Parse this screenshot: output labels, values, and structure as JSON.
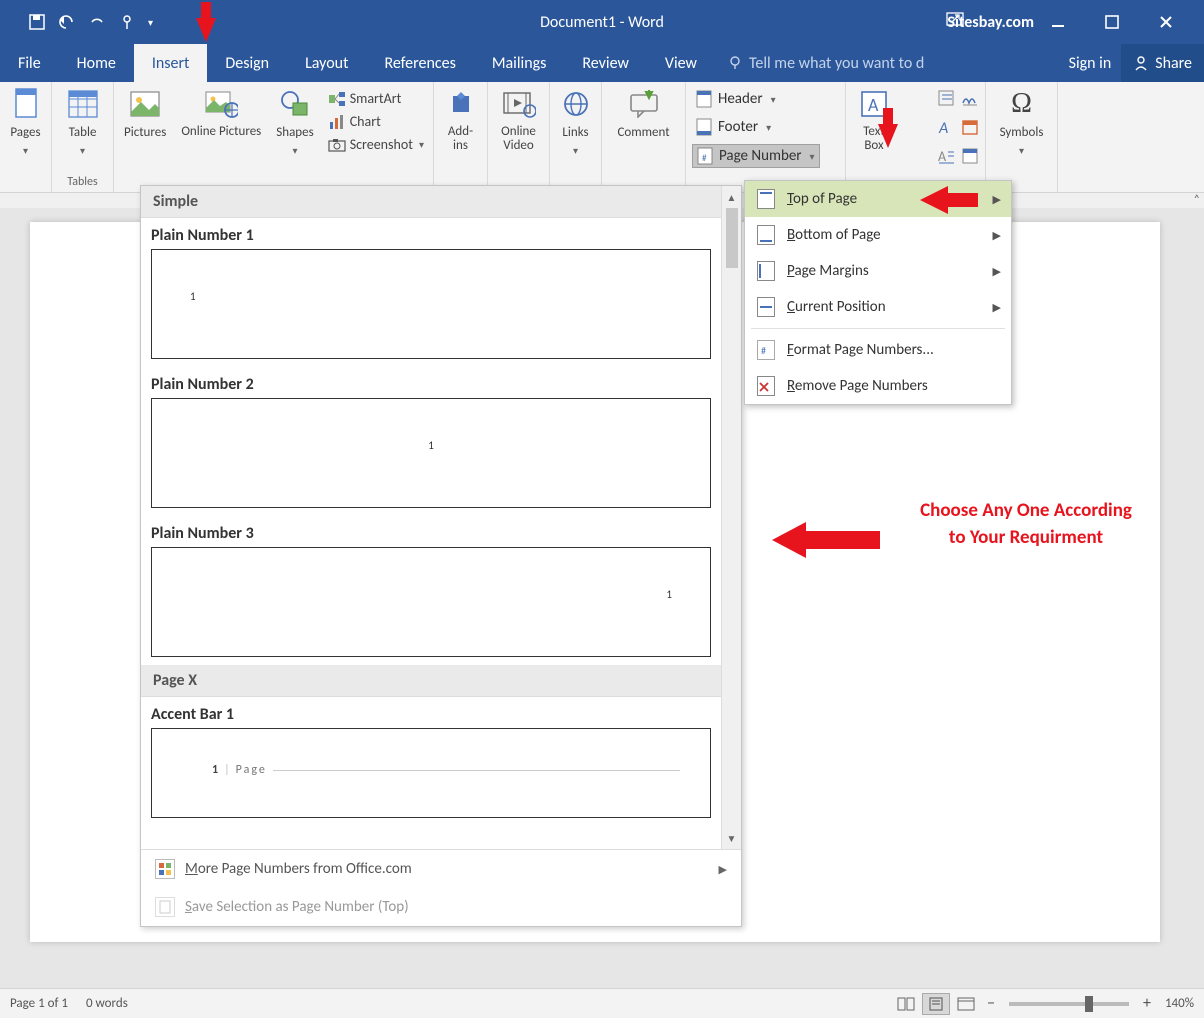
{
  "title": "Document1 - Word",
  "watermark": "Sitesbay.com",
  "tabs": {
    "file": "File",
    "home": "Home",
    "insert": "Insert",
    "design": "Design",
    "layout": "Layout",
    "references": "References",
    "mailings": "Mailings",
    "review": "Review",
    "view": "View",
    "tell": "Tell me what you want to d",
    "signin": "Sign in",
    "share": "Share"
  },
  "ribbon": {
    "pages": "Pages",
    "table": "Table",
    "tables_group": "Tables",
    "pictures": "Pictures",
    "online_pictures": "Online Pictures",
    "shapes": "Shapes",
    "smartart": "SmartArt",
    "chart": "Chart",
    "screenshot": "Screenshot",
    "addins": "Add-ins",
    "online_video": "Online Video",
    "links": "Links",
    "comment": "Comment",
    "header": "Header",
    "footer": "Footer",
    "page_number": "Page Number",
    "text_box": "Text Box",
    "symbols": "Symbols"
  },
  "pn_menu": {
    "top": "Top of Page",
    "bottom": "Bottom of Page",
    "margins": "Page Margins",
    "current": "Current Position",
    "format": "Format Page Numbers...",
    "remove": "Remove Page Numbers"
  },
  "gallery": {
    "cat1": "Simple",
    "p1": "Plain Number 1",
    "p2": "Plain Number 2",
    "p3": "Plain Number 3",
    "cat2": "Page X",
    "ab1": "Accent Bar 1",
    "accent_text": "Page",
    "more": "More Page Numbers from Office.com",
    "save_sel": "Save Selection as Page Number (Top)",
    "num": "1"
  },
  "status": {
    "page": "Page 1 of 1",
    "words": "0 words",
    "zoom": "140%"
  },
  "annotation": {
    "line1": "Choose Any One According",
    "line2": "to Your Requirment"
  }
}
